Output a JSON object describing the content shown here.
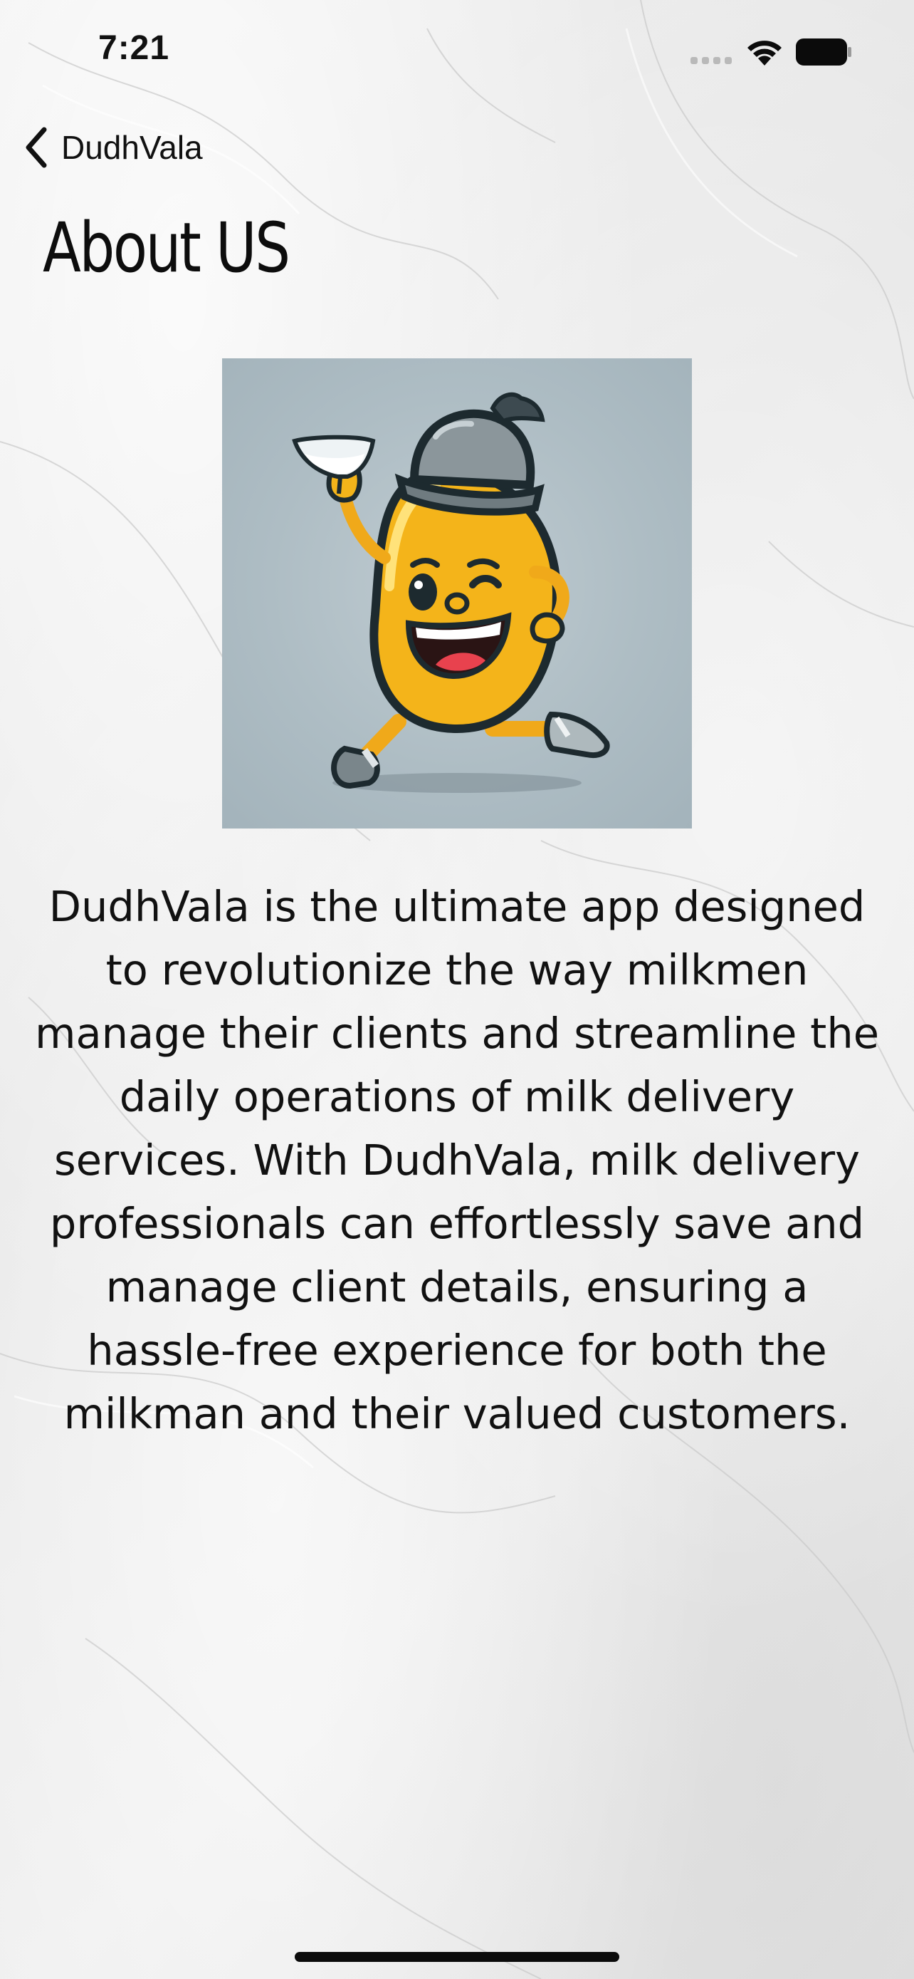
{
  "status_bar": {
    "time": "7:21"
  },
  "nav": {
    "back_label": "DudhVala",
    "back_icon": "chevron-left-icon"
  },
  "page": {
    "title": "About US",
    "mascot_image": "milkman-mascot",
    "description": "DudhVala is the ultimate app designed to revolutionize the way milkmen manage their clients and streamline the daily operations of milk delivery services. With DudhVala, milk delivery professionals can effortlessly save and manage client details, ensuring a hassle-free experience for both the milkman and their valued customers."
  },
  "colors": {
    "mascot_yellow": "#f4b41a",
    "mascot_card_bg": "#aebdc4",
    "text": "#111111"
  }
}
